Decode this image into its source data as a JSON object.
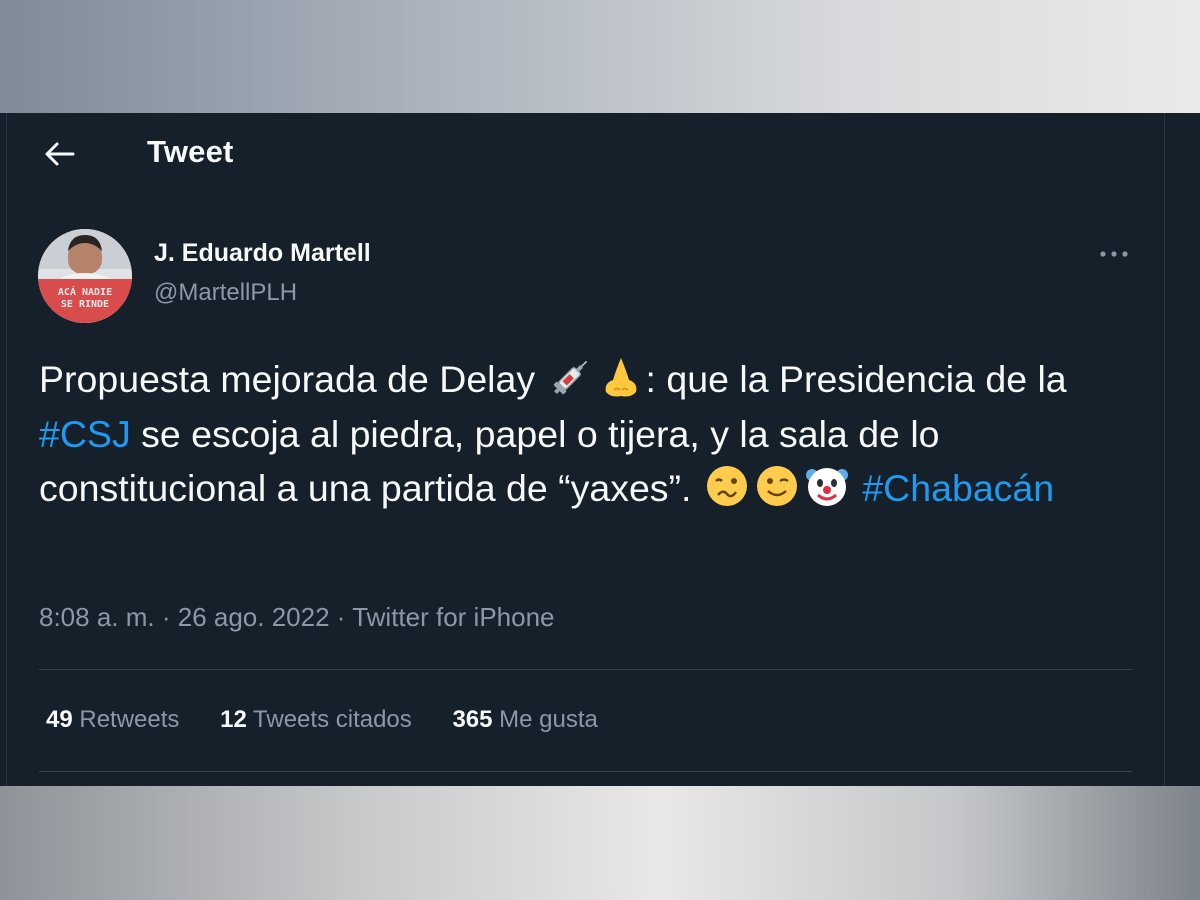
{
  "header": {
    "title": "Tweet",
    "back_icon": "arrow-left-icon"
  },
  "author": {
    "display_name": "J. Eduardo Martell",
    "handle": "@MartellPLH",
    "avatar_banner_line1": "ACÁ NADIE",
    "avatar_banner_line2": "SE RINDE"
  },
  "tweet": {
    "text_1": "Propuesta mejorada de Delay ",
    "emoji_1": "syringe-emoji",
    "emoji_2": "nose-emoji",
    "text_2": ": que la Presidencia de la ",
    "hashtag_1": "#CSJ",
    "text_3": " se escoja al piedra, papel o tijera, y la sala de lo constitucional a una partida de “yaxes”. ",
    "emoji_3": "woozy-face-emoji",
    "emoji_4": "winking-face-emoji",
    "emoji_5": "clown-face-emoji",
    "hashtag_2": "#Chabacán"
  },
  "meta": {
    "time": "8:08 a. m.",
    "separator": " · ",
    "date": "26 ago. 2022",
    "source": "Twitter for iPhone"
  },
  "stats": {
    "retweets_count": "49",
    "retweets_label": "Retweets",
    "quotes_count": "12",
    "quotes_label": "Tweets citados",
    "likes_count": "365",
    "likes_label": "Me gusta"
  },
  "colors": {
    "background": "#15202b",
    "text_primary": "#f7f9f9",
    "text_secondary": "#8b98a5",
    "accent": "#1d9bf0",
    "divider": "#38444d"
  }
}
